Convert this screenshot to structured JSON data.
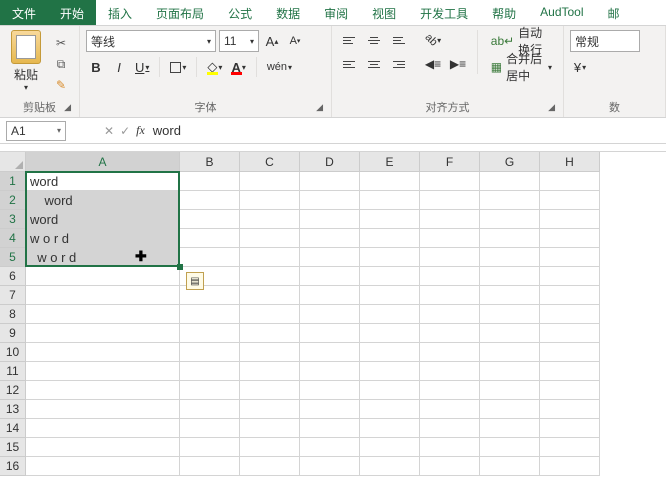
{
  "tabs": {
    "file": "文件",
    "items": [
      "开始",
      "插入",
      "页面布局",
      "公式",
      "数据",
      "审阅",
      "视图",
      "开发工具",
      "帮助",
      "AudTool",
      "邮"
    ],
    "active_index": 0
  },
  "ribbon": {
    "clipboard": {
      "paste": "粘贴",
      "label": "剪贴板"
    },
    "font": {
      "name": "等线",
      "size": "11",
      "label": "字体",
      "bold": "B",
      "italic": "I",
      "underline": "U",
      "increase": "A",
      "decrease": "A",
      "phonetic": "wén"
    },
    "alignment": {
      "label": "对齐方式",
      "wrap": "自动换行",
      "merge": "合并后居中"
    },
    "number": {
      "format": "常规",
      "label": "数"
    }
  },
  "namebox": {
    "value": "A1"
  },
  "formula": {
    "fx": "fx",
    "value": "word"
  },
  "grid": {
    "col_widths": {
      "A": 154,
      "rest": 60
    },
    "columns": [
      "A",
      "B",
      "C",
      "D",
      "E",
      "F",
      "G",
      "H"
    ],
    "row_count": 16,
    "selected_rows": [
      1,
      2,
      3,
      4,
      5
    ],
    "selected_col": "A",
    "active_cell": "A1",
    "cells": {
      "A1": "word",
      "A2": "    word",
      "A3": "word",
      "A4": "w o r d",
      "A5": "  w o r d"
    }
  }
}
